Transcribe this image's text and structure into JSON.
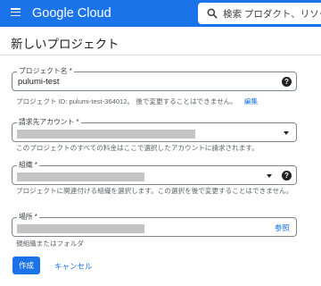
{
  "header": {
    "logo_text": "Google Cloud",
    "search_placeholder": "検索  プロダクト、リソース"
  },
  "page": {
    "title": "新しいプロジェクト"
  },
  "project_name": {
    "label": "プロジェクト名 *",
    "value": "pulumi-test",
    "hint": "プロジェクト ID: pulumi-test-364012。 後で変更することはできません。",
    "edit_link": "編集"
  },
  "billing_account": {
    "label": "請求先アカウント *",
    "hint": "このプロジェクトのすべての料金はここで選択したアカウントに請求されます。"
  },
  "organization": {
    "label": "組織 *",
    "hint": "プロジェクトに関連付ける組織を選択します。この選択を後で変更することはできません。"
  },
  "location": {
    "label": "場所 *",
    "browse_link": "参照",
    "hint": "親組織またはフォルダ"
  },
  "actions": {
    "create_label": "作成",
    "cancel_label": "キャンセル"
  },
  "colors": {
    "brand": "#1a73e8",
    "redacted": "#c4c4c4"
  }
}
